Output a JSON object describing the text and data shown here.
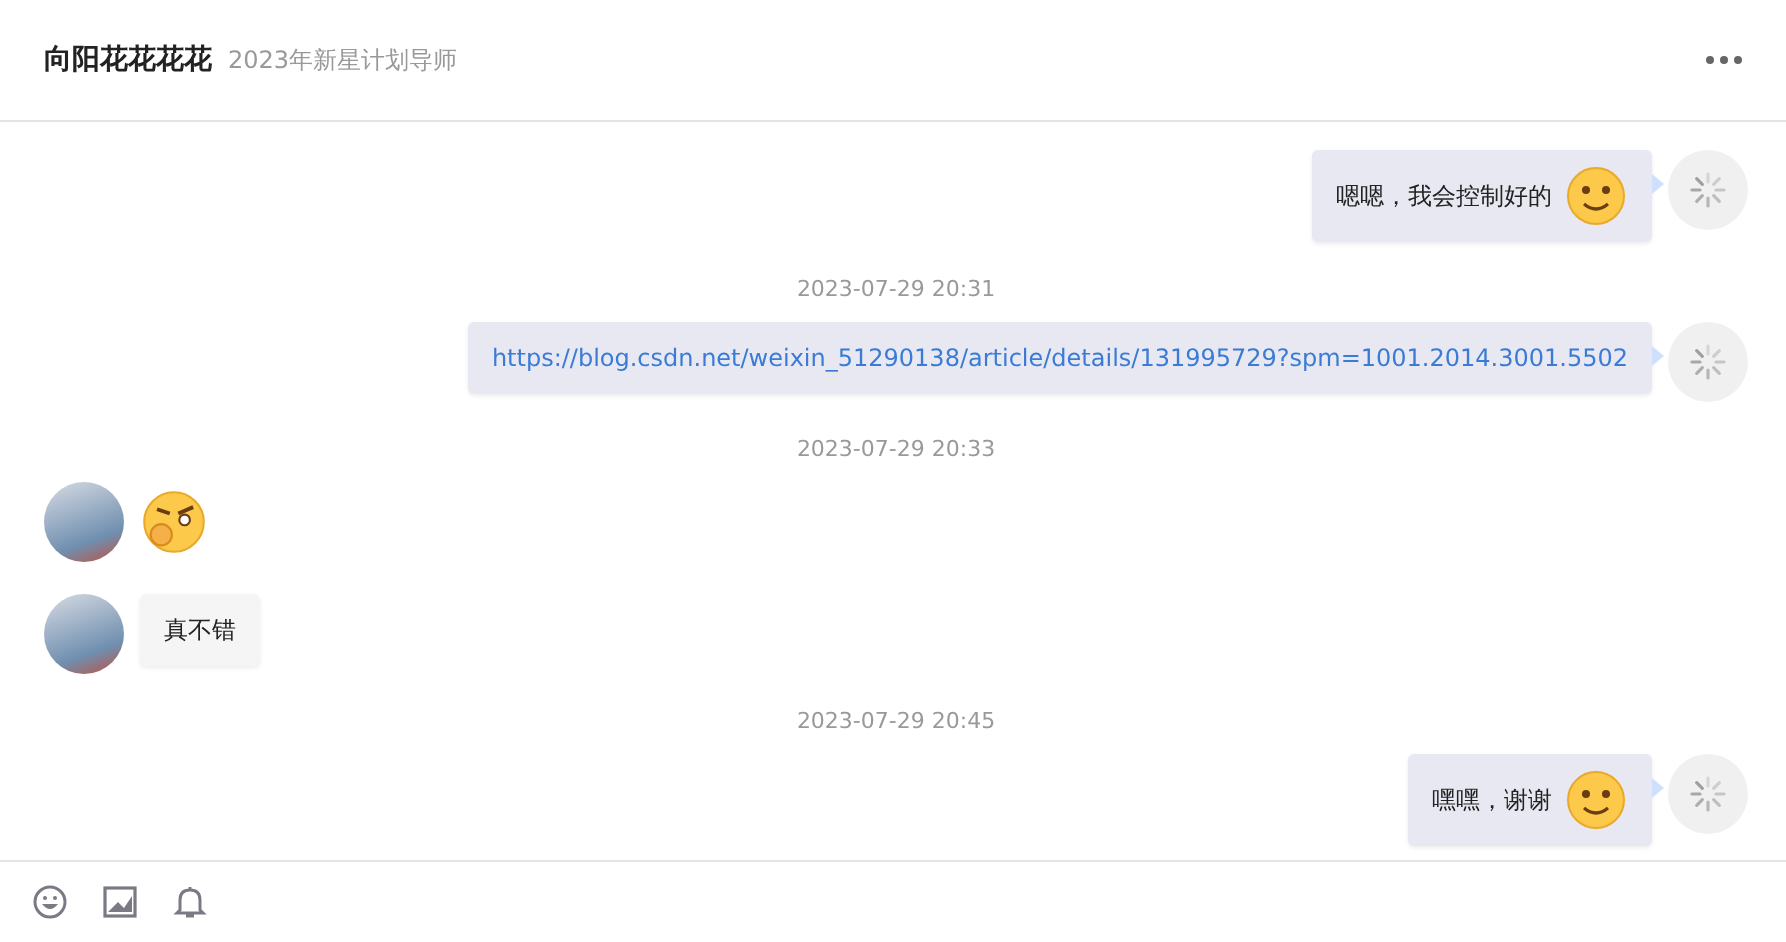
{
  "header": {
    "name": "向阳花花花花",
    "subtitle": "2023年新星计划导师"
  },
  "messages": [
    {
      "kind": "text",
      "outgoing": true,
      "text": "嗯嗯，我会控制好的",
      "sticker": true
    },
    {
      "kind": "time",
      "text": "2023-07-29 20:31"
    },
    {
      "kind": "link",
      "outgoing": true,
      "text": "https://blog.csdn.net/weixin_51290138/article/details/131995729?spm=1001.2014.3001.5502"
    },
    {
      "kind": "time",
      "text": "2023-07-29 20:33"
    },
    {
      "kind": "sticker",
      "outgoing": false
    },
    {
      "kind": "text",
      "outgoing": false,
      "text": "真不错",
      "sticker": false
    },
    {
      "kind": "time",
      "text": "2023-07-29 20:45"
    },
    {
      "kind": "text",
      "outgoing": true,
      "text": "嘿嘿，谢谢",
      "sticker": true
    }
  ]
}
